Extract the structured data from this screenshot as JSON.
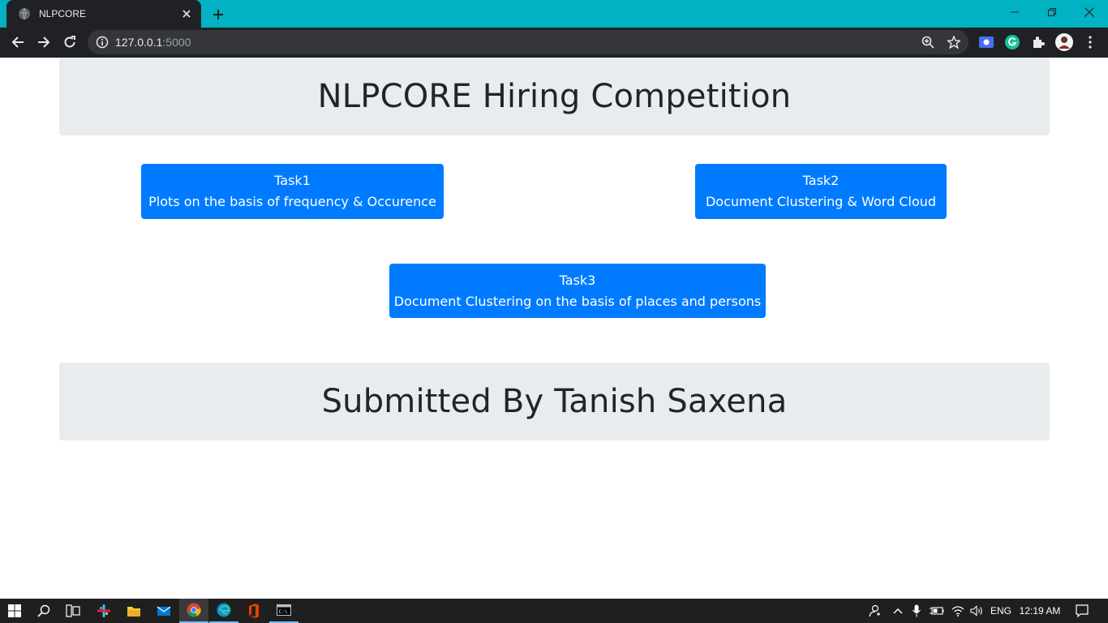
{
  "browser": {
    "tab": {
      "title": "NLPCORE",
      "favicon": "globe-icon"
    },
    "address": {
      "host": "127.0.0.1",
      "port": ":5000"
    },
    "theme_color": "#00b2c2"
  },
  "page": {
    "header_title": "NLPCORE Hiring Competition",
    "tasks": [
      {
        "title": "Task1",
        "description": "Plots on the basis of frequency & Occurence"
      },
      {
        "title": "Task2",
        "description": "Document Clustering & Word Cloud"
      },
      {
        "title": "Task3",
        "description": "Document Clustering on the basis of places and persons"
      }
    ],
    "footer_title": "Submitted By Tanish Saxena",
    "colors": {
      "button": "#007bff",
      "jumbotron": "#e9ecef",
      "text": "#212529"
    }
  },
  "taskbar": {
    "apps": [
      "start-icon",
      "search-icon",
      "task-view-icon",
      "slack-icon",
      "file-explorer-icon",
      "mail-icon",
      "chrome-icon",
      "edge-icon",
      "office-icon",
      "terminal-icon"
    ],
    "language": "ENG",
    "time": "12:19 AM"
  }
}
